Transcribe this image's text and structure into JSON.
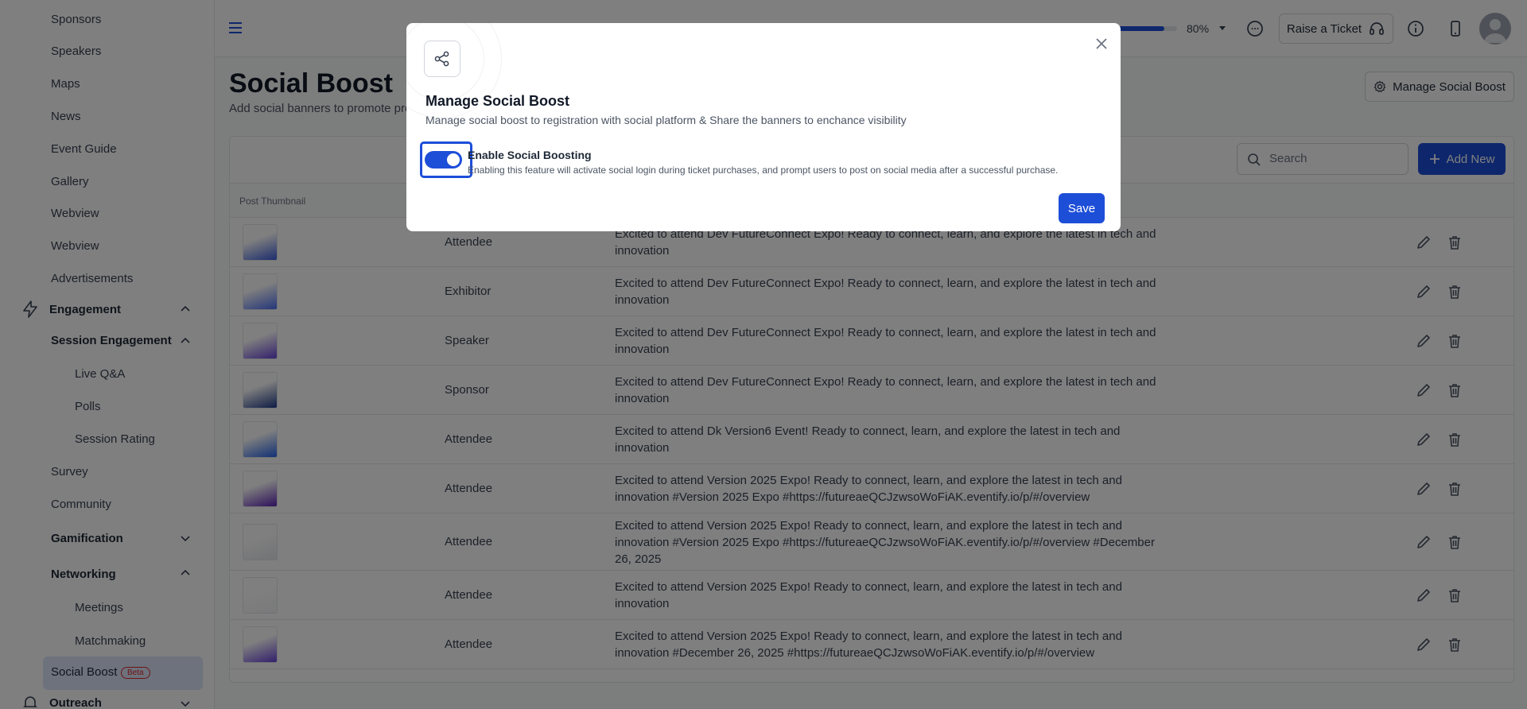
{
  "sidebar": {
    "items": [
      {
        "label": "Sponsors"
      },
      {
        "label": "Speakers"
      },
      {
        "label": "Maps"
      },
      {
        "label": "News"
      },
      {
        "label": "Event Guide"
      },
      {
        "label": "Gallery"
      },
      {
        "label": "Webview"
      },
      {
        "label": "Webview"
      },
      {
        "label": "Advertisements"
      }
    ],
    "engagement": {
      "label": "Engagement",
      "session_engagement": "Session Engagement",
      "session_children": [
        "Live Q&A",
        "Polls",
        "Session Rating"
      ],
      "survey": "Survey",
      "community": "Community",
      "gamification": "Gamification",
      "networking": "Networking",
      "networking_children": [
        "Meetings",
        "Matchmaking"
      ],
      "social_boost": "Social Boost",
      "social_boost_badge": "Beta"
    },
    "outreach": "Outreach"
  },
  "topbar": {
    "progress": 80,
    "progress_label": "80%",
    "ticket_button": "Raise a Ticket"
  },
  "page": {
    "title": "Social Boost",
    "subtitle": "Add social banners to promote pro",
    "manage_button": "Manage Social Boost",
    "search_placeholder": "Search",
    "add_button": "Add New",
    "columns": [
      "Post Thumbnail"
    ],
    "rows": [
      {
        "role": "Attendee",
        "caption": "Excited to attend Dev FutureConnect Expo! Ready to connect, learn, and explore the latest in tech and innovation"
      },
      {
        "role": "Exhibitor",
        "caption": "Excited to attend Dev FutureConnect Expo! Ready to connect, learn, and explore the latest in tech and innovation"
      },
      {
        "role": "Speaker",
        "caption": "Excited to attend Dev FutureConnect Expo! Ready to connect, learn, and explore the latest in tech and innovation"
      },
      {
        "role": "Sponsor",
        "caption": "Excited to attend Dev FutureConnect Expo! Ready to connect, learn, and explore the latest in tech and innovation"
      },
      {
        "role": "Attendee",
        "caption": "Excited to attend Dk Version6 Event! Ready to connect, learn, and explore the latest in tech and innovation"
      },
      {
        "role": "Attendee",
        "caption": "Excited to attend Version 2025 Expo! Ready to connect, learn, and explore the latest in tech and innovation #Version 2025 Expo #https://futureaeQCJzwsoWoFiAK.eventify.io/p/#/overview"
      },
      {
        "role": "Attendee",
        "caption": "Excited to attend Version 2025 Expo! Ready to connect, learn, and explore the latest in tech and innovation #Version 2025 Expo #https://futureaeQCJzwsoWoFiAK.eventify.io/p/#/overview #December 26, 2025"
      },
      {
        "role": "Attendee",
        "caption": "Excited to attend Version 2025 Expo! Ready to connect, learn, and explore the latest in tech and innovation"
      },
      {
        "role": "Attendee",
        "caption": "Excited to attend Version 2025 Expo! Ready to connect, learn, and explore the latest in tech and innovation #December 26, 2025 #https://futureaeQCJzwsoWoFiAK.eventify.io/p/#/overview"
      }
    ]
  },
  "modal": {
    "title": "Manage Social Boost",
    "subtitle": "Manage social boost to registration with social platform & Share the banners to enchance visibility",
    "toggle_label": "Enable Social Boosting",
    "toggle_desc": "Enabling this feature will activate social login during ticket purchases, and prompt users to post on social media after a successful purchase.",
    "toggle_on": true,
    "save_button": "Save"
  },
  "colors": {
    "accent": "#1d4ed8",
    "overlay": "rgba(0,0,0,0.5)",
    "active_nav": "#dbe4fb"
  }
}
